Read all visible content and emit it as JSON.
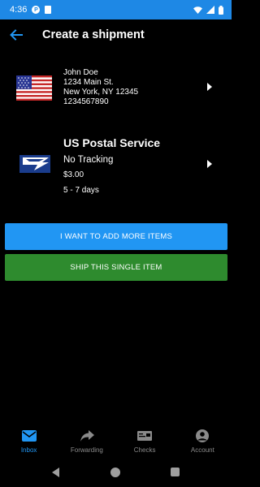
{
  "status_bar": {
    "time": "4:36",
    "badge": "P"
  },
  "header": {
    "title": "Create a shipment",
    "back_icon": "arrow-left-icon"
  },
  "address": {
    "flag_icon": "us-flag-icon",
    "name": "John Doe",
    "street": "1234 Main St.",
    "city_line": "New York, NY 12345",
    "phone": "1234567890"
  },
  "carrier": {
    "icon": "usps-eagle-icon",
    "name": "US Postal Service",
    "tracking": "No Tracking",
    "price": "$3.00",
    "eta": "5 - 7 days"
  },
  "actions": {
    "add_more_label": "I WANT TO ADD MORE ITEMS",
    "ship_single_label": "SHIP THIS SINGLE ITEM"
  },
  "bottom_nav": {
    "items": [
      {
        "label": "Inbox",
        "icon": "envelope-icon",
        "active": true
      },
      {
        "label": "Forwarding",
        "icon": "forward-arrow-icon",
        "active": false
      },
      {
        "label": "Checks",
        "icon": "check-money-icon",
        "active": false
      },
      {
        "label": "Account",
        "icon": "account-circle-icon",
        "active": false
      }
    ]
  },
  "colors": {
    "accent": "#2196f3",
    "status_bar": "#1e88e5",
    "ship_button": "#2e8b2e",
    "background": "#000000"
  }
}
